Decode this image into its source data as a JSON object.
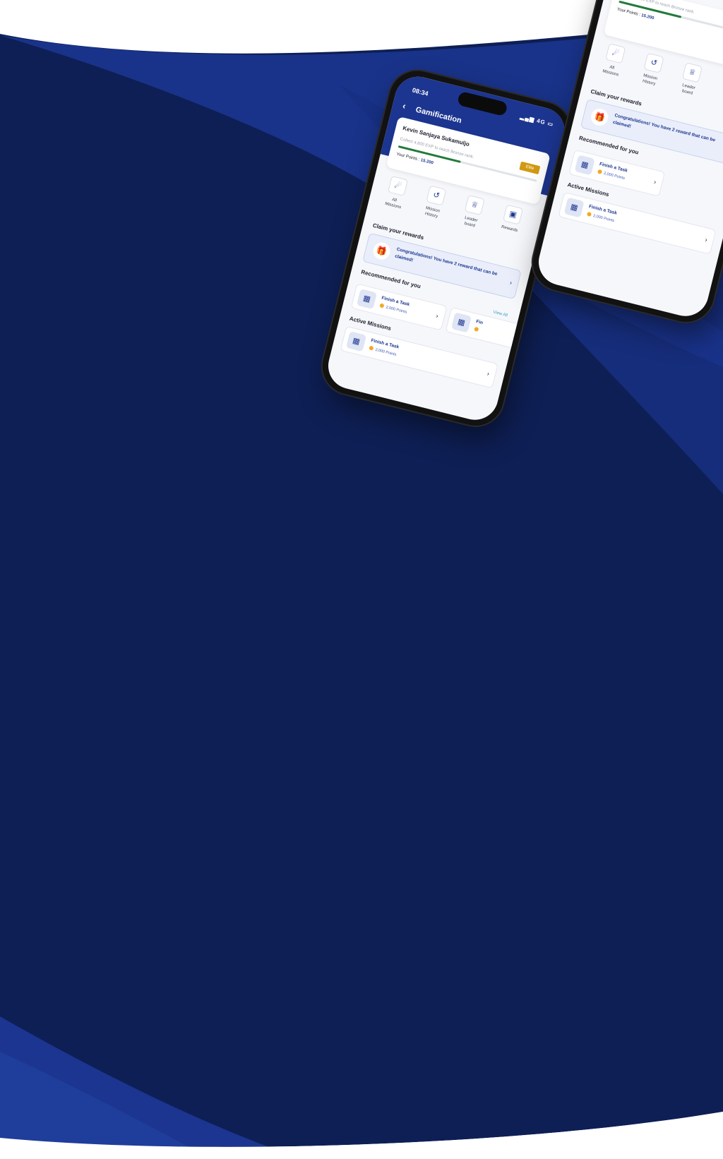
{
  "status": {
    "time": "08:34",
    "network": "4G"
  },
  "screen": {
    "title": "Gamification"
  },
  "profile": {
    "name": "Kevin Sanjaya Sukamuljo",
    "rank_badge": "Elite",
    "progress_text": "Collect 4,800 EXP to reach Bronze rank.",
    "points_label": "Your Points :",
    "points_value": "15.200",
    "progress_fraction": 0.45
  },
  "menu": [
    {
      "label": "All\nMissions",
      "icon": "rocket-icon"
    },
    {
      "label": "Mission\nHistory",
      "icon": "history-icon"
    },
    {
      "label": "Leader\nboard",
      "icon": "trophy-icon"
    },
    {
      "label": "Rewards",
      "icon": "gift-icon"
    }
  ],
  "claim": {
    "title": "Claim your rewards",
    "message": "Congratulations! You have 2 reward that can be claimed!"
  },
  "recommended": {
    "title": "Recommended for you",
    "view_all": "View All",
    "items": [
      {
        "title": "Finish a Task",
        "points": "2,000 Points"
      },
      {
        "title": "Fin",
        "points": ""
      }
    ]
  },
  "active": {
    "title": "Active Missions",
    "items": [
      {
        "title": "Finish a Task",
        "points": "2,000 Points"
      }
    ]
  },
  "colors": {
    "background_dark": "#0e1f55",
    "background_accent": "#1b3590",
    "header_blue": "#1c3590",
    "badge_gold": "#d19a12",
    "progress_green": "#227a3c"
  }
}
